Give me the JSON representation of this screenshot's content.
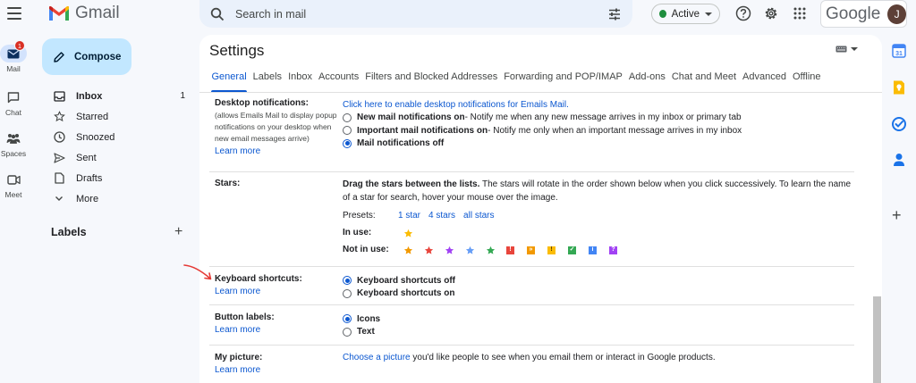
{
  "app": {
    "name": "Gmail"
  },
  "search": {
    "placeholder": "Search in mail"
  },
  "status": {
    "label": "Active"
  },
  "account": {
    "brand": "Google",
    "avatar_letter": "J"
  },
  "rail": [
    {
      "label": "Mail",
      "badge": "1"
    },
    {
      "label": "Chat"
    },
    {
      "label": "Spaces"
    },
    {
      "label": "Meet"
    }
  ],
  "compose": {
    "label": "Compose"
  },
  "nav": [
    {
      "label": "Inbox",
      "count": "1"
    },
    {
      "label": "Starred"
    },
    {
      "label": "Snoozed"
    },
    {
      "label": "Sent"
    },
    {
      "label": "Drafts"
    },
    {
      "label": "More"
    }
  ],
  "labels": {
    "title": "Labels"
  },
  "settings": {
    "title": "Settings",
    "tabs": [
      "General",
      "Labels",
      "Inbox",
      "Accounts",
      "Filters and Blocked Addresses",
      "Forwarding and POP/IMAP",
      "Add-ons",
      "Chat and Meet",
      "Advanced",
      "Offline"
    ],
    "desktop": {
      "label": "Desktop notifications:",
      "sub": "(allows Emails Mail to display popup notifications on your desktop when new email messages arrive)",
      "learn": "Learn more",
      "link": "Click here to enable desktop notifications for Emails Mail.",
      "opt1_b": "New mail notifications on",
      "opt1_t": " - Notify me when any new message arrives in my inbox or primary tab",
      "opt2_b": "Important mail notifications on",
      "opt2_t": " - Notify me only when an important message arrives in my inbox",
      "opt3_b": "Mail notifications off"
    },
    "stars": {
      "label": "Stars:",
      "desc_b": "Drag the stars between the lists.",
      "desc_t": "  The stars will rotate in the order shown below when you click successively. To learn the name of a star for search, hover your mouse over the image.",
      "presets_label": "Presets:",
      "preset1": "1 star",
      "preset2": "4 stars",
      "preset3": "all stars",
      "inuse_label": "In use:",
      "notinuse_label": "Not in use:"
    },
    "keyboard": {
      "label": "Keyboard shortcuts:",
      "learn": "Learn more",
      "opt1": "Keyboard shortcuts off",
      "opt2": "Keyboard shortcuts on"
    },
    "buttons": {
      "label": "Button labels:",
      "learn": "Learn more",
      "opt1": "Icons",
      "opt2": "Text"
    },
    "picture": {
      "label": "My picture:",
      "learn": "Learn more",
      "link": "Choose a picture",
      "text": " you'd like people to see when you email them or interact in Google products."
    }
  },
  "colors": {
    "accent": "#0b57d0",
    "compose_bg": "#c2e7ff",
    "active_green": "#1e8e3e",
    "annotation_red": "#e53935"
  }
}
